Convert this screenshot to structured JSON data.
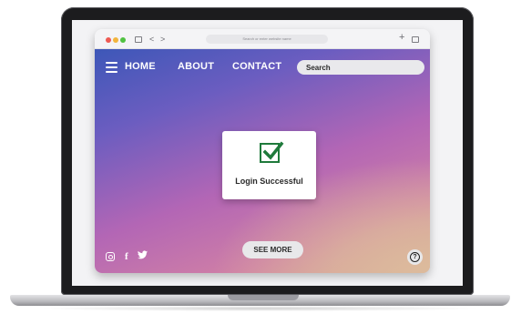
{
  "browser": {
    "url_placeholder": "Search or enter website name",
    "back_glyph": "<",
    "forward_glyph": ">",
    "new_tab_glyph": "+"
  },
  "nav": {
    "links": [
      "HOME",
      "ABOUT",
      "CONTACT"
    ],
    "search_placeholder": "Search"
  },
  "card": {
    "message": "Login Successful",
    "icon": "checkbox-checked-icon",
    "icon_color": "#1f7a3b"
  },
  "footer": {
    "see_more_label": "SEE MORE",
    "social_icons": [
      "instagram-icon",
      "facebook-icon",
      "twitter-icon"
    ],
    "facebook_glyph": "f",
    "help_glyph": "?"
  },
  "colors": {
    "gradient_start": "#3d57b8",
    "gradient_mid": "#b366b5",
    "gradient_end": "#dcbb9c"
  }
}
